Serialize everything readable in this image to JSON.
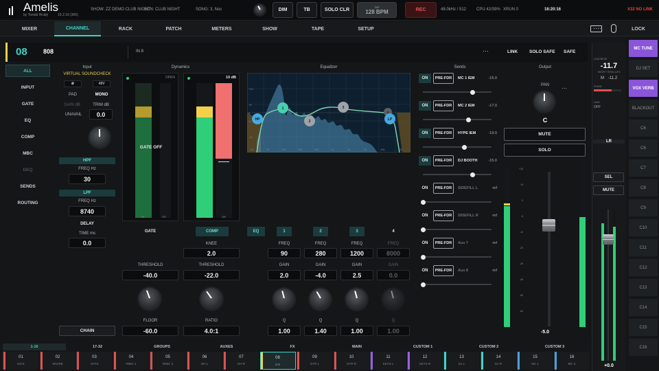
{
  "app": {
    "name": "Amelis",
    "byline": "by Tomáš Hrubý",
    "version": "15.2.16 (306)"
  },
  "topbar": {
    "show": "SHOW: ZZ DEMO CLUB NIGHT",
    "scene": "SCN: CLUB NIGHT",
    "song": "SONG: 3, Noc",
    "dim": "DIM",
    "tb": "TB",
    "solo_clr": "SOLO CLR",
    "tap": "TAP",
    "bpm": "128 BPM",
    "rec": "REC",
    "samplerate": "48.0kHz / 512",
    "cpu": "CPU 42/39%",
    "xrun": "XRUN 0",
    "time": "16:20:16",
    "link_status": "X32 NO LINK"
  },
  "nav": {
    "items": [
      "MIXER",
      "CHANNEL",
      "RACK",
      "PATCH",
      "METERS",
      "SHOW",
      "TAPE",
      "SETUP"
    ],
    "active": "CHANNEL",
    "lock": "LOCK"
  },
  "channel": {
    "number": "08",
    "name": "808",
    "input_src": "IN  8",
    "more": "···",
    "link": "LINK",
    "solo_safe": "SOLO SAFE",
    "safe": "SAFE"
  },
  "sidebar": {
    "items": [
      "ALL",
      "INPUT",
      "GATE",
      "EQ",
      "COMP",
      "MBC",
      "DEQ",
      "SENDS",
      "ROUTING"
    ],
    "active": "ALL",
    "disabled": "DEQ",
    "chain": "CHAIN"
  },
  "input": {
    "title": "Input",
    "soundcheck": "VIRTUAL SOUNDCHECK",
    "phase": "ø",
    "v48": "48V",
    "pad": "PAD",
    "mono": "MONO",
    "gain_label": "GAIN dB",
    "trim_label": "TRIM dB",
    "unavail": "UNAVAIL",
    "trim_value": "0.0",
    "hpf": "HPF",
    "hpf_freq_label": "FREQ Hz",
    "hpf_freq": "30",
    "lpf": "LPF",
    "lpf_freq_label": "FREQ Hz",
    "lpf_freq": "8740",
    "delay": "DELAY",
    "time_label": "TIME ms",
    "time_value": "0.0"
  },
  "dynamics": {
    "title": "Dynamics",
    "gate_open": "OPEN",
    "gate_off": "GATE OFF",
    "comp_db": "10 dB",
    "scale_labels": [
      "0",
      "-6",
      "-12",
      "-18",
      "-24",
      "-30",
      "-36",
      "-42",
      "-48",
      "-54",
      "-60"
    ],
    "gr_labels": [
      "0",
      "3",
      "6",
      "9",
      "12",
      "15",
      "18",
      "21",
      "24"
    ],
    "in": "IN",
    "gr": "GR",
    "gate": "GATE",
    "comp": "COMP",
    "knee_label": "KNEE",
    "knee": "2.0",
    "thr_label": "THRESHOLD",
    "gate_threshold": "-40.0",
    "comp_threshold": "-22.0",
    "floor_label": "FLOOR",
    "floor": "-60.0",
    "ratio_label": "RATIO",
    "ratio": "4.0:1",
    "gate_level": 0.1,
    "comp_in_level": 0.82,
    "comp_gr_level": 0.65
  },
  "eq": {
    "title": "Equalizer",
    "bands": [
      {
        "label": "EQ",
        "on": true
      },
      {
        "label": "1",
        "on": true
      },
      {
        "label": "2",
        "on": true
      },
      {
        "label": "3",
        "on": true
      },
      {
        "label": "4",
        "on": false
      }
    ],
    "freq_label": "FREQ",
    "gain_label": "GAIN",
    "q_label": "Q",
    "freqs": [
      "90",
      "280",
      "1200",
      "8000"
    ],
    "gains": [
      "2.0",
      "-4.0",
      "2.5",
      "0.0"
    ],
    "qs": [
      "1.00",
      "1.40",
      "1.00",
      "1.00"
    ],
    "x_ticks": [
      "20",
      "50",
      "100",
      "200",
      "500",
      "1k",
      "2k",
      "5k",
      "10k",
      "20k"
    ],
    "y_ticks": [
      "+12",
      "+6",
      "0",
      "-6",
      "-12"
    ],
    "nodes": [
      "HP",
      "1",
      "2",
      "3",
      "4",
      "LP"
    ]
  },
  "sends": {
    "title": "Sends",
    "items": [
      {
        "on": "ON",
        "mode": "PRE-FDR",
        "name": "MC 1 IEM",
        "value": "-15.0",
        "active": true,
        "level": 0.72
      },
      {
        "on": "ON",
        "mode": "PRE-FDR",
        "name": "MC 2 IEM",
        "value": "-17.0",
        "active": true,
        "level": 0.66
      },
      {
        "on": "ON",
        "mode": "PRE-FDR",
        "name": "HYPE IEM",
        "value": "-19.0",
        "active": true,
        "level": 0.6
      },
      {
        "on": "ON",
        "mode": "PRE-FDR",
        "name": "DJ BOOTH",
        "value": "-15.0",
        "active": true,
        "level": 0.72
      },
      {
        "on": "ON",
        "mode": "PRE-FDR",
        "name": "SIDEFILL L",
        "value": "-inf",
        "active": false,
        "level": 0
      },
      {
        "on": "ON",
        "mode": "PRE-FDR",
        "name": "SIDEFILL R",
        "value": "-inf",
        "active": false,
        "level": 0
      },
      {
        "on": "ON",
        "mode": "PRE-FDR",
        "name": "Aux 7",
        "value": "-inf",
        "active": false,
        "level": 0
      },
      {
        "on": "ON",
        "mode": "PRE-FDR",
        "name": "Aux 8",
        "value": "-inf",
        "active": false,
        "level": 0
      }
    ]
  },
  "output": {
    "title": "Output",
    "pan_label": "PAN",
    "pan_value": "C",
    "more": "···",
    "mute": "MUTE",
    "solo": "SOLO",
    "fader_value": "-5.0",
    "scale": [
      "+10",
      "+5",
      "0",
      "-5",
      "-10",
      "-20",
      "-30",
      "-40",
      "-50",
      "-60"
    ]
  },
  "master": {
    "loudness": "LOUDNESS",
    "value": "-11.7",
    "subtitle": "SHORT TERM LUFS",
    "m_label": "M",
    "m_value": "-11.2",
    "lr": "LR",
    "sel": "SEL",
    "mute": "MUTE",
    "fader_value": "+0.0",
    "row_labels": [
      "PHASE",
      "GAIN"
    ],
    "row_off": "OFF"
  },
  "scenes": {
    "items": [
      "MC TUNE",
      "DJ SET",
      "VOX VERB",
      "BLACKOUT",
      "C6",
      "C6",
      "C7",
      "C8",
      "C9",
      "C10",
      "C11",
      "C12",
      "C13",
      "C14",
      "C15",
      "C16"
    ],
    "active": [
      "MC TUNE",
      "VOX VERB"
    ]
  },
  "banks": {
    "items": [
      "1-16",
      "17-32",
      "GROUPS",
      "AUXES",
      "FX",
      "MAIN",
      "CUSTOM 1",
      "CUSTOM 2",
      "CUSTOM 3"
    ],
    "active": "1-16"
  },
  "strips": [
    {
      "n": "01",
      "name": "KICK",
      "color": "#e05050"
    },
    {
      "n": "02",
      "name": "SNARE",
      "color": "#e05050"
    },
    {
      "n": "03",
      "name": "HATS",
      "color": "#e05050"
    },
    {
      "n": "04",
      "name": "RMIC 1",
      "color": "#e05050"
    },
    {
      "n": "05",
      "name": "RMIC 2",
      "color": "#e05050"
    },
    {
      "n": "06",
      "name": "OH L",
      "color": "#e05050"
    },
    {
      "n": "07",
      "name": "OH R",
      "color": "#e05050"
    },
    {
      "n": "08",
      "name": "808",
      "color": "#f2d04a"
    },
    {
      "n": "09",
      "name": "GTR L",
      "color": "#e05050"
    },
    {
      "n": "10",
      "name": "GTR R",
      "color": "#e05050"
    },
    {
      "n": "11",
      "name": "KEYS L",
      "color": "#9b5fe0"
    },
    {
      "n": "12",
      "name": "KEYS R",
      "color": "#9b5fe0"
    },
    {
      "n": "13",
      "name": "DJ L",
      "color": "#3fd4c8"
    },
    {
      "n": "14",
      "name": "DJ R",
      "color": "#3fd4c8"
    },
    {
      "n": "15",
      "name": "MC 1",
      "color": "#4aa0e0"
    },
    {
      "n": "16",
      "name": "MC 2",
      "color": "#4aa0e0"
    }
  ],
  "colors": {
    "accent": "#3fd4c8",
    "yellow": "#f2d04a",
    "meter_green": "#2fcf7a",
    "rec": "#c03030",
    "purple": "#9b5fe0"
  }
}
